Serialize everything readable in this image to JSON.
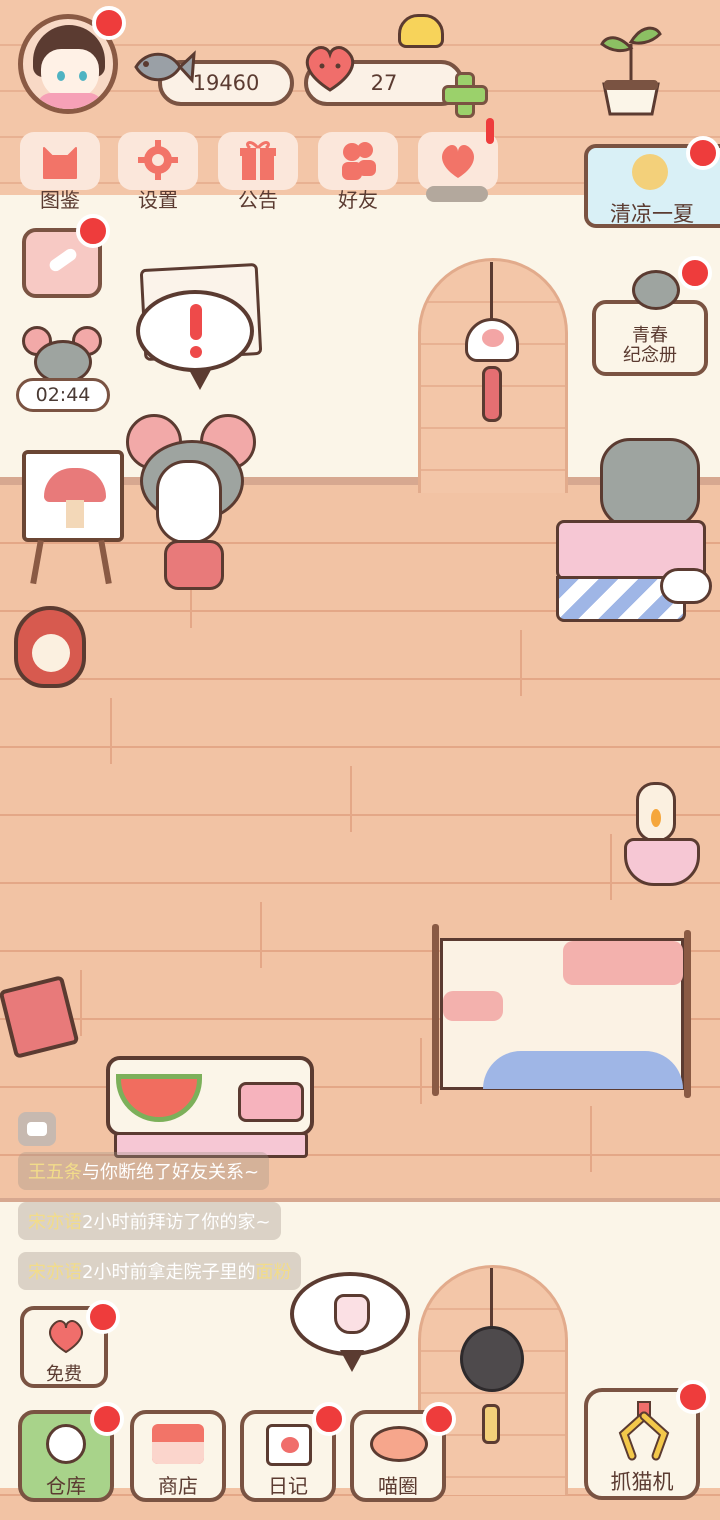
{
  "hud": {
    "fish_count": "19460",
    "heart_count": "27"
  },
  "menu": [
    {
      "label": "图鉴",
      "icon": "cat-head-icon"
    },
    {
      "label": "设置",
      "icon": "gear-icon"
    },
    {
      "label": "公告",
      "icon": "gift-icon"
    },
    {
      "label": "好友",
      "icon": "friends-icon"
    },
    {
      "label": "",
      "icon": "heart-broken-icon"
    }
  ],
  "event_banner": {
    "label": "清凉一夏"
  },
  "side": {
    "timer": "02:44",
    "youth_label": "青春\n纪念册"
  },
  "feed": [
    {
      "name": "王五条",
      "text": "与你断绝了好友关系~",
      "extra_name": "",
      "extra_text": ""
    },
    {
      "name": "宋亦语",
      "text": "2小时前拜访了你的家~",
      "extra_name": "",
      "extra_text": ""
    },
    {
      "name": "宋亦语",
      "text": "2小时前拿走院子里的",
      "extra_name": "面粉",
      "extra_text": ""
    }
  ],
  "bottom": {
    "free": "免费",
    "warehouse": "仓库",
    "shop": "商店",
    "diary": "日记",
    "circle": "喵圈",
    "claw": "抓猫机"
  },
  "colors": {
    "wood": "#f2c3a4",
    "wall": "#fbf5e8",
    "outline": "#7a5342",
    "badge": "#ee3c3c",
    "active": "#a8d38a"
  }
}
